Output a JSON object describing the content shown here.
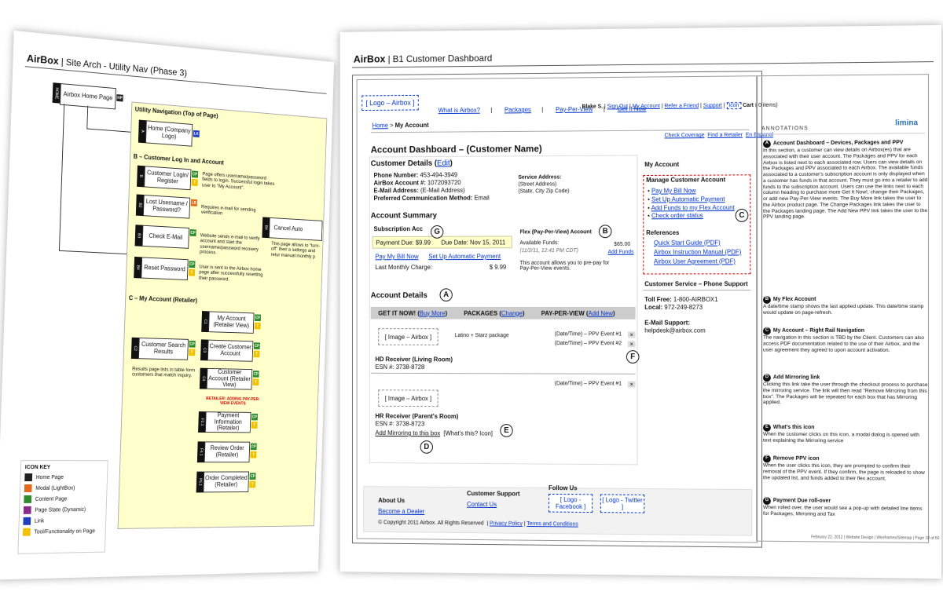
{
  "left": {
    "brand": "AirBox",
    "title": "Site Arch - Utility Nav (Phase 3)",
    "home_box": "Airbox Home Page",
    "home_tag": "HOME",
    "hp_tag": "HP",
    "utility_title": "Utility Navigation (Top of Page)",
    "home_logo": "Home (Company Logo)",
    "sec_b": "B – Customer Log In and Account",
    "login": "Customer Login/ Register",
    "login_note": "Page offers username/password fields to login. Successful login takes user to \"My Account\".",
    "lost": "Lost Username / Password?",
    "lost_note": "Requires e-mail for sending verification",
    "cancel": "Cancel Auto",
    "cancel_note": "This page allows to \"turn-off\" their a settings and retur manual monthly p",
    "check": "Check E-Mail",
    "check_note": "Website sends e-mail to verify account and start the username/password recovery process.",
    "reset": "Reset Password",
    "reset_note": "User is sent to the Airbox home page after successfully resetting their password.",
    "sec_c": "C – My Account (Retailer)",
    "myacct": "My Account (Retailer View)",
    "search": "Customer Search Results",
    "create": "Create Customer Account",
    "search_note": "Results page lists in table form customers that match inquiry.",
    "custacct": "Customer Account (Retailer View)",
    "retailer_note": "RETAILER: ADDING PAY-PER-VIEW EVENTS",
    "payinfo": "Payment Information (Retailer)",
    "review": "Review Order (Retailer)",
    "completed": "Order Completed (Retailer)",
    "icon_key_title": "ICON KEY",
    "icon_key": [
      {
        "label": "Home Page",
        "color": "#222222",
        "code": "HP"
      },
      {
        "label": "Modal (LightBox)",
        "color": "#e06a1b",
        "code": "LB"
      },
      {
        "label": "Content Page",
        "color": "#2e8b2e",
        "code": "CP"
      },
      {
        "label": "Page State (Dynamic)",
        "color": "#8b2b8b",
        "code": "PS"
      },
      {
        "label": "Link",
        "color": "#1f3fbf",
        "code": "LK"
      },
      {
        "label": "Tool/Functionality on Page",
        "color": "#f2c200",
        "code": "T"
      }
    ]
  },
  "right": {
    "brand": "AirBox",
    "title": "B1 Customer Dashboard",
    "logo": "[ Logo – Airbox ]",
    "nav": [
      "What is Airbox?",
      "Packages",
      "Pay-Per-View",
      "Get It Now"
    ],
    "user": "Blake S.",
    "sign_out": "Sign Out",
    "my_account": "My Account",
    "refer": "Refer a Friend",
    "support": "Support",
    "icon_label": "Icon",
    "cart": "Cart",
    "cart_count": "( 0 items)",
    "breadcrumb_home": "Home",
    "breadcrumb_current": "My Account",
    "check_coverage": "Check Coverage",
    "find_retailer": "Find a Retailer",
    "espanol": "En Espanol",
    "dash_title": "Account Dashboard – (Customer Name)",
    "cust_details": "Customer Details",
    "edit": "Edit",
    "phone_label": "Phone Number:",
    "phone": "453-494-3949",
    "acct_label": "AirBox Account #:",
    "acct": "1072093720",
    "email_label": "E-Mail Address:",
    "email": "(E-Mail Address)",
    "pref_label": "Preferred Communication Method:",
    "pref": "Email",
    "svc_label": "Service Address:",
    "svc1": "(Street Address)",
    "svc2": "(State, City Zip Code)",
    "acct_summary": "Account Summary",
    "sub_acct": "Subscription Acc",
    "pay_due": "Payment Due: $9.99",
    "due_date": "Due Date: Nov 15, 2011",
    "pay_bill": "Pay My Bill Now",
    "setup_auto": "Set Up Automatic Payment",
    "last_charge_label": "Last Monthly Charge:",
    "last_charge": "$ 9.99",
    "flex_title": "Flex (Pay-Per-View) Account",
    "avail_label": "Available Funds:",
    "avail": "$65.00",
    "flex_time": "(11/2/11, 12:41 PM CDT)",
    "add_funds": "Add Funds",
    "flex_desc": "This account allows you to pre-pay for Pay-Per-View events.",
    "acct_details": "Account Details",
    "get_it": "GET IT NOW!",
    "buy_more": "Buy More",
    "packages_h": "PACKAGES",
    "change": "Change",
    "ppv_h": "PAY-PER-VIEW",
    "add_new": "Add New",
    "image1": "[ Image – Airbox ]",
    "pkg1": "Latino + Starz package",
    "ppv1a": "(Date/Time) – PPV Event #1",
    "ppv1b": "(Date/Time) – PPV Event #2",
    "box1_name": "HD Receiver (Living Room)",
    "box1_esn": "ESN #: 3738-8728",
    "image2": "[ Image – Airbox ]",
    "ppv2a": "(Date/Time) – PPV Event #1",
    "box2_name": "HR Receiver (Parent's Room)",
    "box2_esn": "ESN #: 3738-8723",
    "add_mirror": "Add Mirroring to this box",
    "whats_this": "[What's this? Icon]",
    "my_account_h": "My Account",
    "manage_h": "Manage Customer Account",
    "manage_links": [
      "Pay My Bill Now",
      "Set Up Automatic Payment",
      "Add Funds to my Flex Account",
      "Check order status"
    ],
    "refs_h": "References",
    "refs": [
      "Quick Start Guide (PDF)",
      "Airbox Instruction Manual (PDF)",
      "Airbox User Agreement (PDF)"
    ],
    "cs_h": "Customer Service – Phone Support",
    "tollfree_label": "Toll Free:",
    "tollfree": "1-800-AIRBOX1",
    "local_label": "Local:",
    "local": "972-249-8273",
    "esupport_h": "E-Mail Support:",
    "esupport": "helpdesk@airbox.com",
    "about": "About Us",
    "dealer": "Become a Dealer",
    "cs_support": "Customer Support",
    "contact": "Contact Us",
    "follow": "Follow Us",
    "fb": "[ Logo - Facebook ]",
    "tw": "[ Logo - Twitter ]",
    "copyright": "© Copyright 2011 Airbox.  All Rights Reserved",
    "privacy": "Privacy Policy",
    "terms": "Terms and Conditions",
    "annotations_title": "ANNOTATIONS",
    "limina": "limina",
    "annotations": [
      {
        "k": "A",
        "h": "Account Dashboard – Devices, Packages and PPV",
        "b": "In this section, a customer can view details on Airbox(es) that are associated with their user account. The Packages and PPV for each Airbox is listed next to each associated row. Users can view details on the Packages and PPV associated to each Airbox. The available funds associated to a customer's subscription account is only displayed when a customer has funds in that account. They must go into a retailer to add funds to the subscription account.  Users can use the links next to each column heading to purchase more Get It Now!, change their Packages, or add new Pay-Per-View events. The Buy More link takes the user to the Airbox product page. The Change Packages link takes the user to the Packages landing page. The Add New PPV link takes the user to the PPV landing page."
      },
      {
        "k": "B",
        "h": "My Flex Account",
        "b": "A date/time stamp shows the last applied update. This date/time stamp would update on page-refresh."
      },
      {
        "k": "C",
        "h": "My Account – Right Rail Navigation",
        "b": "The navigation in this section is TBD by the Client. Customers can also access PDF documentation related to the use of their Airbox, and the user agreement they agreed to upon account activation."
      },
      {
        "k": "D",
        "h": "Add Mirroring link",
        "b": "Clicking this link take the user through the checkout process to purchase the mirroring service. The link will then read \"Remove Mirroring from this box\". The Packages will be repeated for each box that has Mirroring applied."
      },
      {
        "k": "E",
        "h": "What's this icon",
        "b": "When the customer clicks on this icon, a modal dialog is opened with text explaining the Mirroring service"
      },
      {
        "k": "F",
        "h": "Remove PPV icon",
        "b": "When the user clicks this icon, they are prompted to confirm their removal of the PPV event. If they confirm, the page is reloaded to show the updated list, and funds added to their flex account."
      },
      {
        "k": "G",
        "h": "Payment Due roll-over",
        "b": "When rolled over, the user would see a pop-up with detailed line items for Packages, Mirroring and Tax"
      }
    ],
    "footer_note": "February 22, 2012  |  Website Design  |  Wireframes/Sitemap  |  Page 18 of 50"
  }
}
